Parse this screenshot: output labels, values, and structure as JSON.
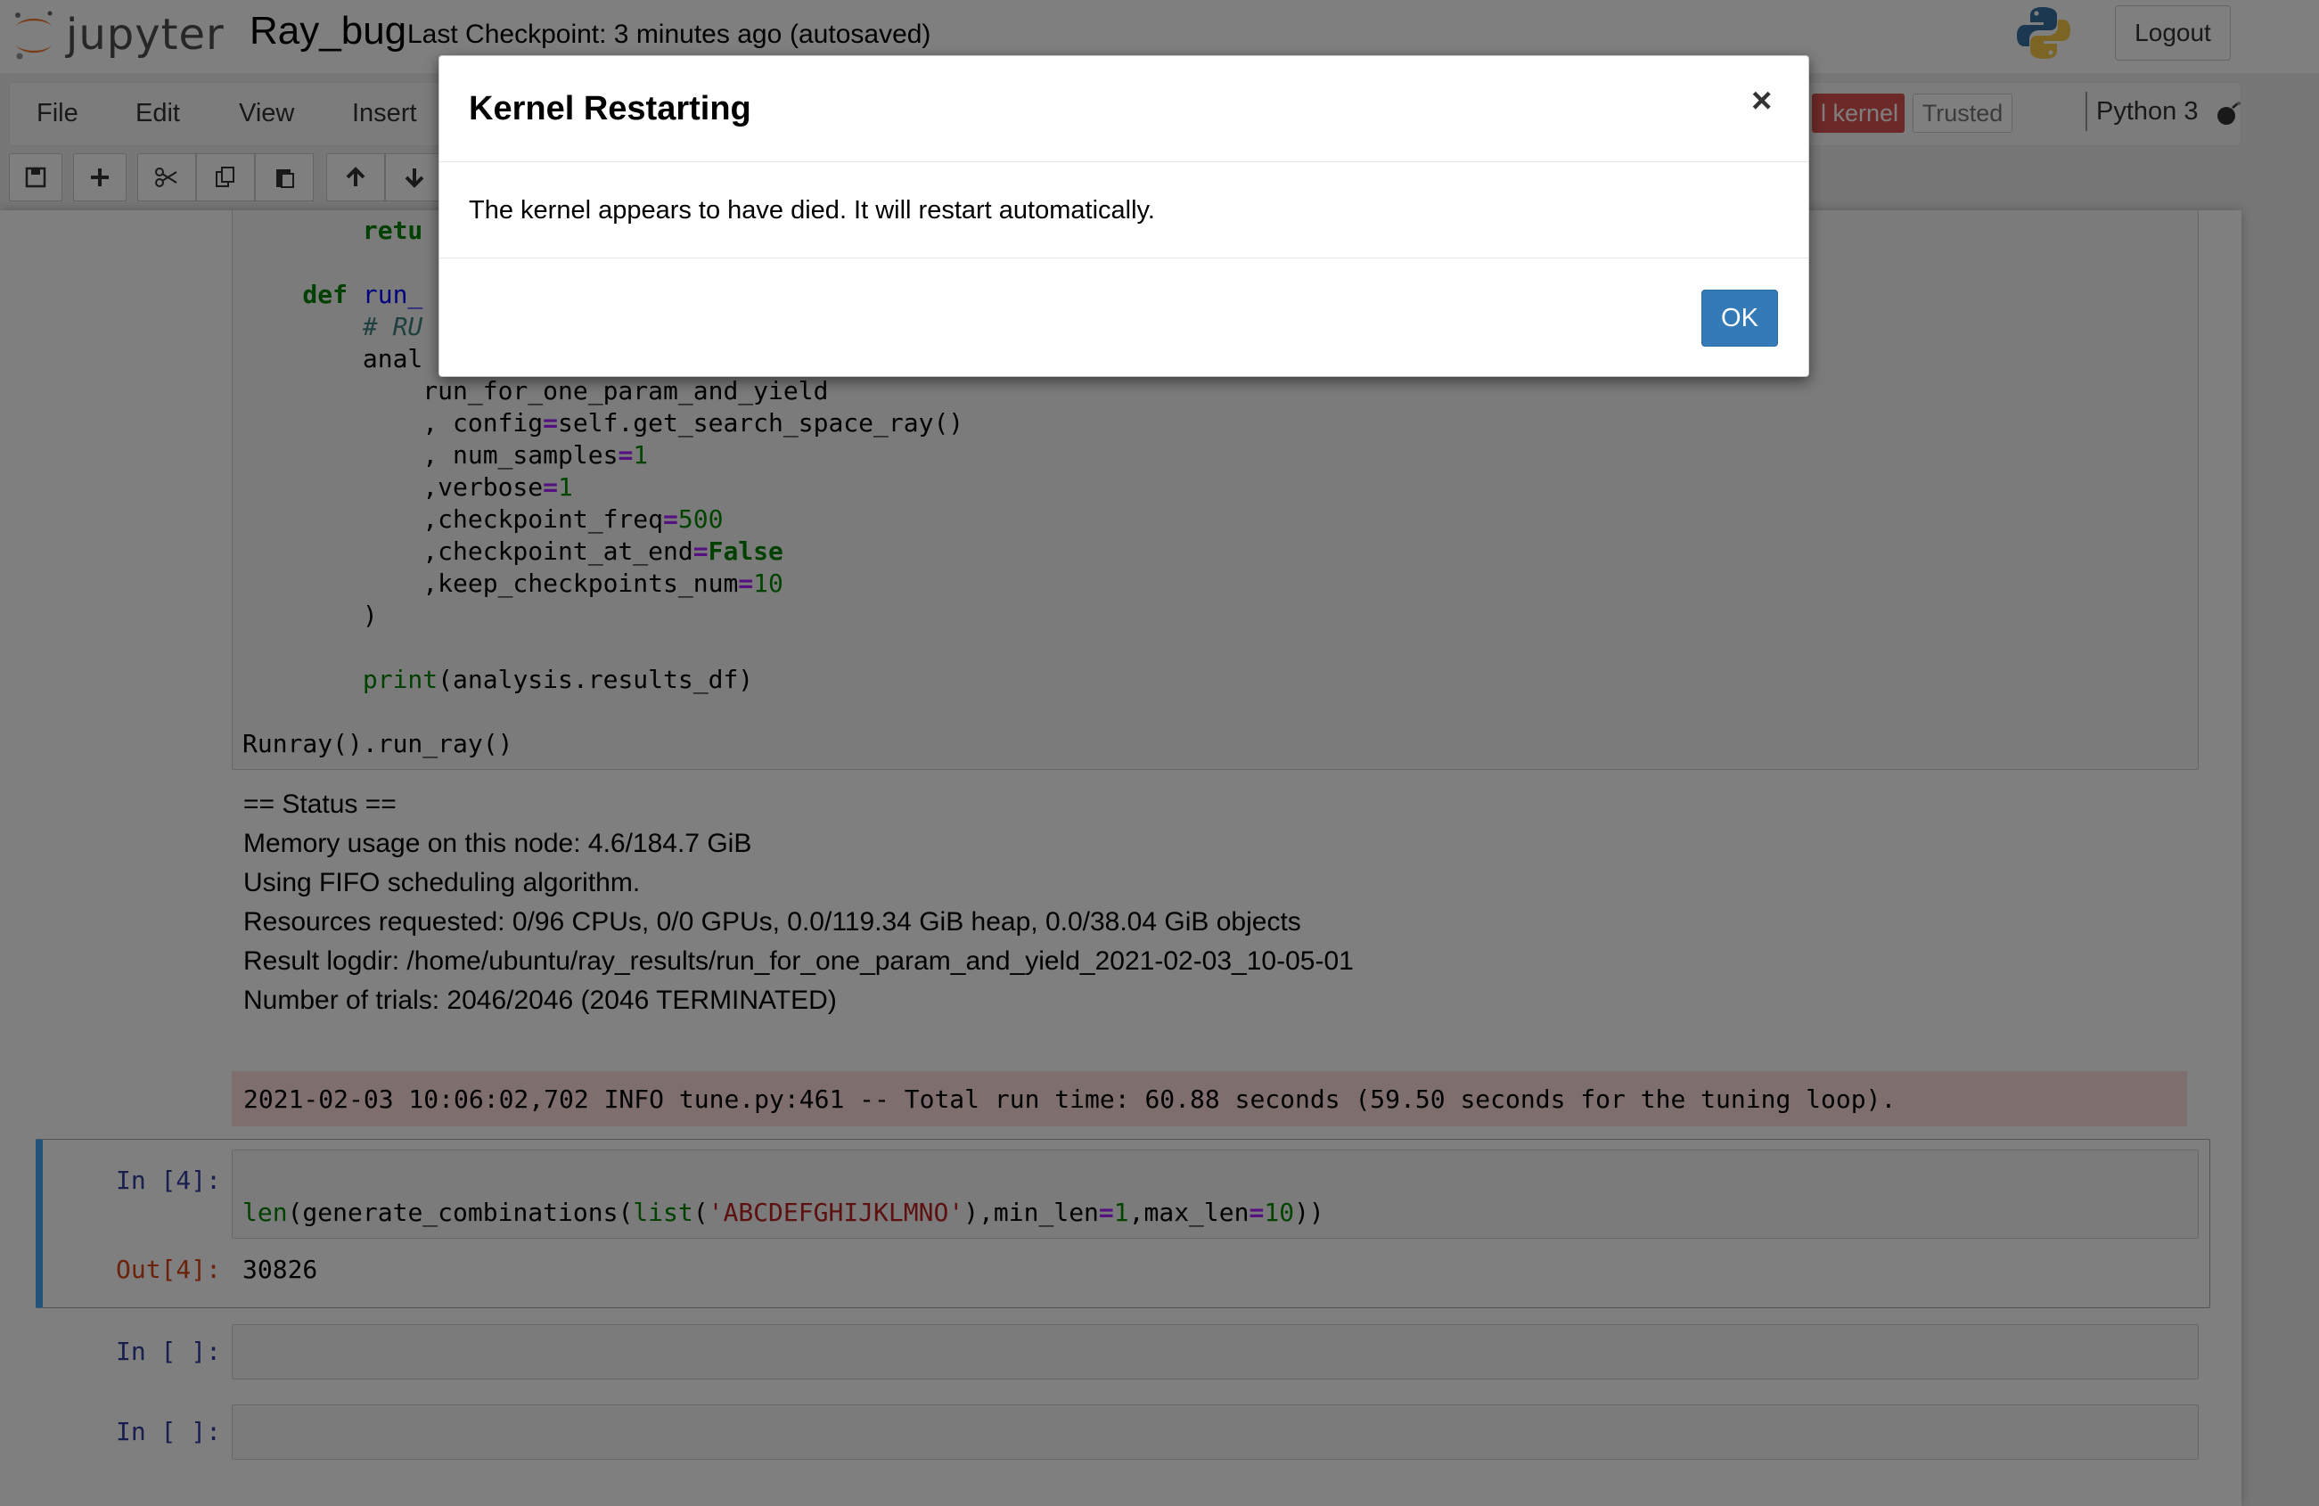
{
  "header": {
    "logo_text": "jupyter",
    "notebook_name": "Ray_bug",
    "checkpoint": "Last Checkpoint: 3 minutes ago",
    "autosave": "(autosaved)",
    "logout_label": "Logout"
  },
  "menubar": {
    "items": [
      "File",
      "Edit",
      "View",
      "Insert"
    ],
    "kernel_badge": "l kernel",
    "trusted": "Trusted",
    "kernel_name": "Python 3"
  },
  "code_cell": {
    "lines": [
      "        retu",
      "    def run_",
      "        # RU",
      "        anal",
      "            run_for_one_param_and_yield",
      "            , config=self.get_search_space_ray()",
      "            , num_samples=1",
      "            ,verbose=1",
      "            ,checkpoint_freq=500",
      "            ,checkpoint_at_end=False",
      "            ,keep_checkpoints_num=10",
      "        )",
      "        print(analysis.results_df)",
      "Runray().run_ray()"
    ]
  },
  "status_output": [
    "== Status ==",
    "Memory usage on this node: 4.6/184.7 GiB",
    "Using FIFO scheduling algorithm.",
    "Resources requested: 0/96 CPUs, 0/0 GPUs, 0.0/119.34 GiB heap, 0.0/38.04 GiB objects",
    "Result logdir: /home/ubuntu/ray_results/run_for_one_param_and_yield_2021-02-03_10-05-01",
    "Number of trials: 2046/2046 (2046 TERMINATED)"
  ],
  "stderr_line": "2021-02-03 10:06:02,702 INFO tune.py:461 -- Total run time: 60.88 seconds (59.50 seconds for the tuning loop).",
  "cell4": {
    "in_prompt": "In [4]:",
    "code": "len(generate_combinations(list('ABCDEFGHIJKLMNO'),min_len=1,max_len=10))",
    "out_prompt": "Out[4]:",
    "output": "30826"
  },
  "empty_cells": [
    {
      "prompt": "In [ ]:"
    },
    {
      "prompt": "In [ ]:"
    }
  ],
  "modal": {
    "title": "Kernel Restarting",
    "close": "×",
    "body": "The kernel appears to have died. It will restart automatically.",
    "ok_label": "OK"
  },
  "colors": {
    "kernel_badge": "#d9534f",
    "ok_button": "#337ab7",
    "selected_cell_border": "#42a5f5",
    "stderr_background": "#ffdddd"
  }
}
